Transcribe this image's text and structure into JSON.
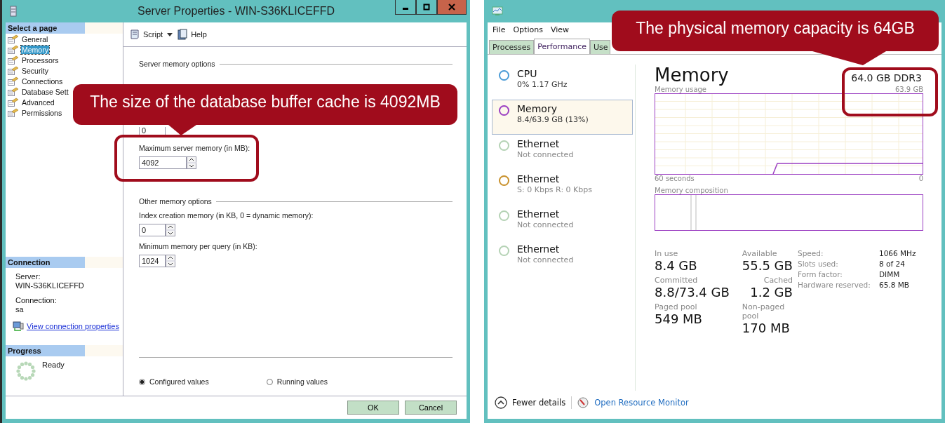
{
  "server_properties": {
    "window": {
      "title": "Server Properties - WIN-S36KLICEFFD"
    },
    "select_page": {
      "heading": "Select a page",
      "items": [
        {
          "label": "General",
          "selected": false
        },
        {
          "label": "Memory",
          "selected": true
        },
        {
          "label": "Processors",
          "selected": false
        },
        {
          "label": "Security",
          "selected": false
        },
        {
          "label": "Connections",
          "selected": false
        },
        {
          "label": "Database Sett",
          "selected": false
        },
        {
          "label": "Advanced",
          "selected": false
        },
        {
          "label": "Permissions",
          "selected": false
        }
      ]
    },
    "toolbar": {
      "script": "Script",
      "help": "Help"
    },
    "server_memory_options": {
      "heading": "Server memory options",
      "min_value": "0",
      "max_label": "Maximum server memory (in MB):",
      "max_value": "4092"
    },
    "other_memory_options": {
      "heading": "Other memory options",
      "fields": [
        {
          "label": "Index creation memory (in KB, 0 = dynamic memory):",
          "value": "0"
        },
        {
          "label": "Minimum memory per query (in KB):",
          "value": "1024"
        }
      ]
    },
    "connection": {
      "heading": "Connection",
      "server_label": "Server:",
      "server": "WIN-S36KLICEFFD",
      "connection_label": "Connection:",
      "connection": "sa",
      "link": "View connection properties"
    },
    "progress": {
      "heading": "Progress",
      "status": "Ready"
    },
    "value_modes": [
      {
        "label": "Configured values",
        "selected": true
      },
      {
        "label": "Running values",
        "selected": false
      }
    ],
    "buttons": [
      "OK",
      "Cancel"
    ]
  },
  "task_manager": {
    "menu": [
      "File",
      "Options",
      "View"
    ],
    "tabs": [
      {
        "label": "Processes",
        "selected": false
      },
      {
        "label": "Performance",
        "selected": true
      },
      {
        "label": "Use",
        "selected": false
      }
    ],
    "resources": [
      {
        "name": "CPU",
        "detail": "0%  1.17 GHz",
        "color": "#4a9bd6",
        "selected": false
      },
      {
        "name": "Memory",
        "detail": "8.4/63.9 GB (13%)",
        "color": "#9b3fc2",
        "selected": true
      },
      {
        "name": "Ethernet",
        "detail": "Not connected",
        "color": "#b4d2b4",
        "selected": false
      },
      {
        "name": "Ethernet",
        "detail": "S: 0 Kbps R: 0 Kbps",
        "color": "#c8902a",
        "selected": false
      },
      {
        "name": "Ethernet",
        "detail": "Not connected",
        "color": "#b4d2b4",
        "selected": false
      },
      {
        "name": "Ethernet",
        "detail": "Not connected",
        "color": "#b4d2b4",
        "selected": false
      }
    ],
    "memory": {
      "title": "Memory",
      "capacity": "64.0 GB DDR3",
      "usage_label": "Memory usage",
      "usage_max": "63.9 GB",
      "time_span": "60 seconds",
      "axis_min": "0",
      "composition_label": "Memory composition",
      "stats": [
        {
          "label": "In use",
          "value": "8.4 GB"
        },
        {
          "label": "Available",
          "value": "55.5 GB"
        },
        {
          "label": "Committed",
          "value": "8.8/73.4 GB"
        },
        {
          "label": "Cached",
          "value": "1.2 GB"
        },
        {
          "label": "Paged pool",
          "value": "549 MB"
        },
        {
          "label": "Non-paged pool",
          "value": "170 MB"
        }
      ],
      "specs": [
        {
          "label": "Speed:",
          "value": "1066 MHz"
        },
        {
          "label": "Slots used:",
          "value": "8 of 24"
        },
        {
          "label": "Form factor:",
          "value": "DIMM"
        },
        {
          "label": "Hardware reserved:",
          "value": "65.8 MB"
        }
      ]
    },
    "footer": {
      "fewer_details": "Fewer details",
      "resource_monitor": "Open Resource Monitor"
    }
  },
  "callouts": [
    {
      "text": "The size of the database buffer cache is 4092MB"
    },
    {
      "text": "The physical memory capacity is 64GB"
    }
  ]
}
